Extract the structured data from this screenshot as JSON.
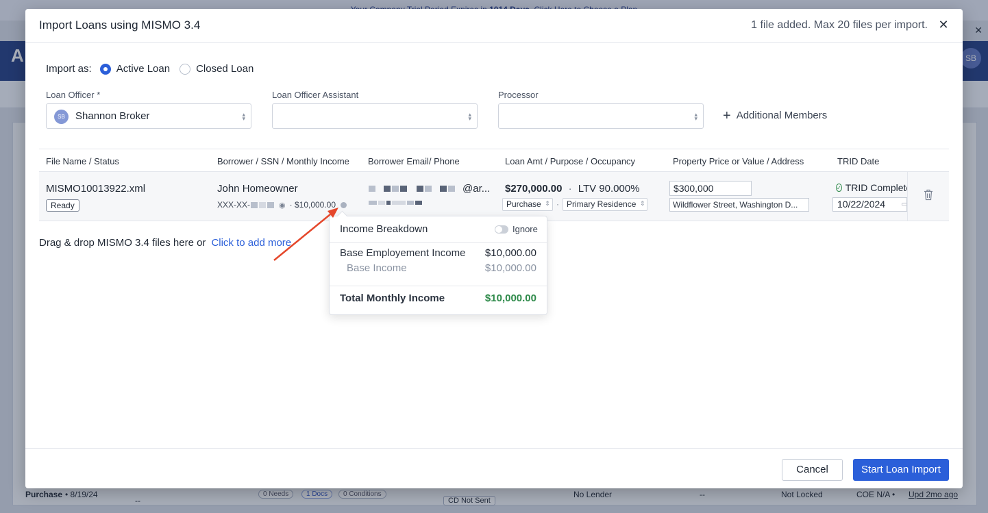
{
  "background": {
    "banner_prefix": "Your Company Trial Period Expires in ",
    "banner_days": "1014 Days",
    "banner_suffix": ". Click Here to Choose a Plan",
    "logo_letter": "A",
    "avatar_initials": "SB",
    "row": {
      "purpose": "Purchase",
      "date": "• 8/19/24",
      "dash1": "--",
      "needs": "0 Needs",
      "docs": "1 Docs",
      "conditions": "0 Conditions",
      "cd_status": "CD Not Sent",
      "lender": "No Lender",
      "dash2": "--",
      "lock": "Not Locked",
      "coe": "COE N/A •",
      "updated": "Upd 2mo ago"
    }
  },
  "modal": {
    "title": "Import Loans using MISMO 3.4",
    "file_count": "1 file added. Max 20 files per import.",
    "import_as_label": "Import as:",
    "import_options": [
      {
        "label": "Active Loan",
        "selected": true
      },
      {
        "label": "Closed Loan",
        "selected": false
      }
    ],
    "fields": {
      "loan_officer": {
        "label": "Loan Officer *",
        "value": "Shannon Broker",
        "initials": "SB"
      },
      "assistant": {
        "label": "Loan Officer Assistant",
        "value": ""
      },
      "processor": {
        "label": "Processor",
        "value": ""
      }
    },
    "additional_members": "Additional Members",
    "columns": [
      "File Name / Status",
      "Borrower / SSN / Monthly Income",
      "Borrower Email/ Phone",
      "Loan Amt / Purpose / Occupancy",
      "Property Price or Value / Address",
      "TRID Date"
    ],
    "row": {
      "file_name": "MISMO10013922.xml",
      "status": "Ready",
      "borrower": "John Homeowner",
      "ssn_prefix": "XXX-XX-",
      "income": "$10,000.00",
      "email_suffix": "@ar...",
      "loan_amount": "$270,000.00",
      "ltv": "LTV 90.000%",
      "purpose": "Purchase",
      "occupancy": "Primary Residence",
      "price": "$300,000",
      "address": "Wildflower Street, Washington D...",
      "trid_status": "TRID Complete",
      "trid_date": "10/22/2024"
    },
    "dropzone_text": "Drag & drop MISMO 3.4 files here or",
    "dropzone_link": "Click to add more",
    "income_popover": {
      "title": "Income Breakdown",
      "toggle_label": "Ignore",
      "base_label": "Base Employement Income",
      "base_value": "$10,000.00",
      "sub_label": "Base Income",
      "sub_value": "$10,000.00",
      "total_label": "Total Monthly Income",
      "total_value": "$10,000.00"
    },
    "cancel_label": "Cancel",
    "start_label": "Start Loan Import"
  },
  "colors": {
    "primary": "#2b5fd9",
    "success": "#2e8a4a",
    "annotation": "#e5472b"
  }
}
